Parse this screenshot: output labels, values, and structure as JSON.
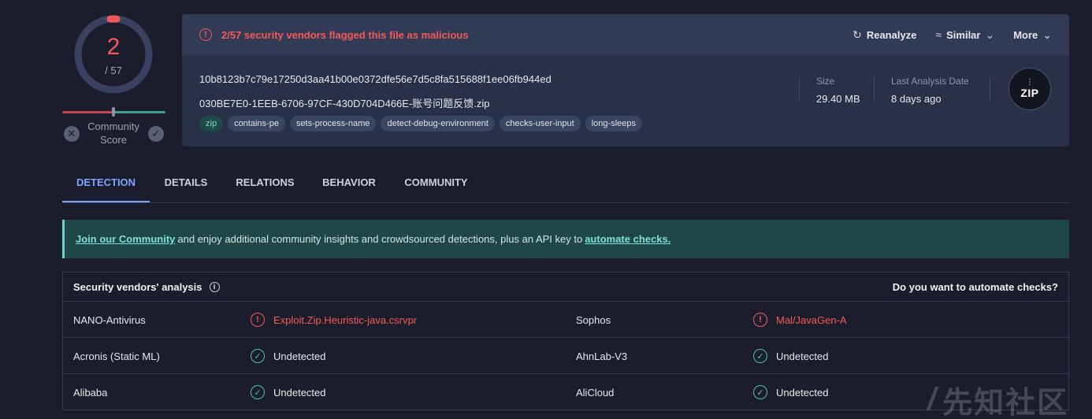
{
  "score": {
    "detections": "2",
    "total": "/ 57",
    "community_label": "Community Score",
    "vote_down": "✕",
    "vote_up": "✓"
  },
  "alert": {
    "icon": "!",
    "text": "2/57 security vendors flagged this file as malicious"
  },
  "actions": {
    "reanalyze": "Reanalyze",
    "similar": "Similar",
    "more": "More"
  },
  "file": {
    "hash": "10b8123b7c79e17250d3aa41b00e0372dfe56e7d5c8fa515688f1ee06fb944ed",
    "name": "030BE7E0-1EEB-6706-97CF-430D704D466E-账号问题反馈.zip",
    "tags": [
      "zip",
      "contains-pe",
      "sets-process-name",
      "detect-debug-environment",
      "checks-user-input",
      "long-sleeps"
    ],
    "size_label": "Size",
    "size_value": "29.40 MB",
    "date_label": "Last Analysis Date",
    "date_value": "8 days ago",
    "type_badge": "ZIP"
  },
  "tabs": [
    "DETECTION",
    "DETAILS",
    "RELATIONS",
    "BEHAVIOR",
    "COMMUNITY"
  ],
  "banner": {
    "link1": "Join our Community",
    "middle": "and enjoy additional community insights and crowdsourced detections, plus an API key to",
    "link2": "automate checks."
  },
  "vendors": {
    "title": "Security vendors' analysis",
    "automate": "Do you want to automate checks?",
    "rows": [
      {
        "v1": "NANO-Antivirus",
        "r1": "Exploit.Zip.Heuristic-java.csrvpr",
        "v2": "Sophos",
        "r2": "Mal/JavaGen-A"
      },
      {
        "v1": "Acronis (Static ML)",
        "r1": "Undetected",
        "v2": "AhnLab-V3",
        "r2": "Undetected"
      },
      {
        "v1": "Alibaba",
        "r1": "Undetected",
        "v2": "AliCloud",
        "r2": "Undetected"
      }
    ]
  },
  "watermark": "先知社区",
  "colors": {
    "malicious": "#f25a5a",
    "clean": "#4fc3a4",
    "accent": "#7fa3ff",
    "background": "#1b1d2c"
  }
}
